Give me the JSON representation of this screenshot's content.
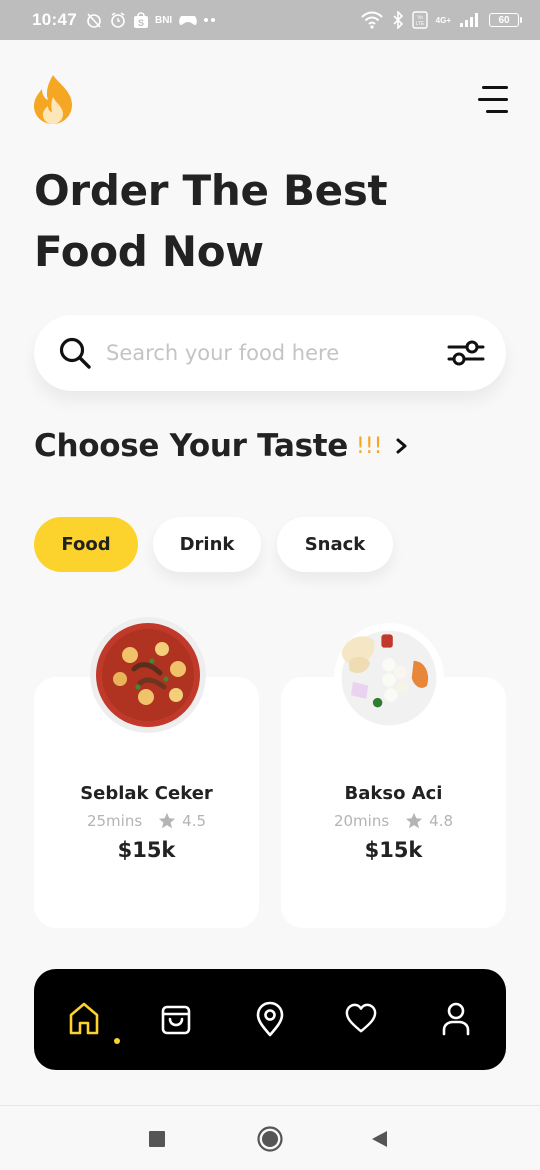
{
  "status_bar": {
    "time": "10:47",
    "bank_label": "BNI",
    "network_label": "4G+",
    "battery": "60"
  },
  "header": {
    "title": "Order The Best Food Now"
  },
  "search": {
    "placeholder": "Search your food here"
  },
  "section": {
    "title": "Choose Your Taste",
    "accent": "!!!"
  },
  "categories": [
    {
      "label": "Food",
      "active": true
    },
    {
      "label": "Drink",
      "active": false
    },
    {
      "label": "Snack",
      "active": false
    }
  ],
  "foods": [
    {
      "name": "Seblak Ceker",
      "time": "25mins",
      "rating": "4.5",
      "price": "$15k"
    },
    {
      "name": "Bakso Aci",
      "time": "20mins",
      "rating": "4.8",
      "price": "$15k"
    }
  ],
  "nav": {
    "items": [
      "home-icon",
      "shopping-bag-icon",
      "location-pin-icon",
      "heart-icon",
      "user-icon"
    ],
    "active_index": 0
  },
  "colors": {
    "accent_yellow": "#fcd32c",
    "accent_orange": "#f5a623",
    "nav_background": "#000000",
    "page_background": "#f8f8f8"
  }
}
